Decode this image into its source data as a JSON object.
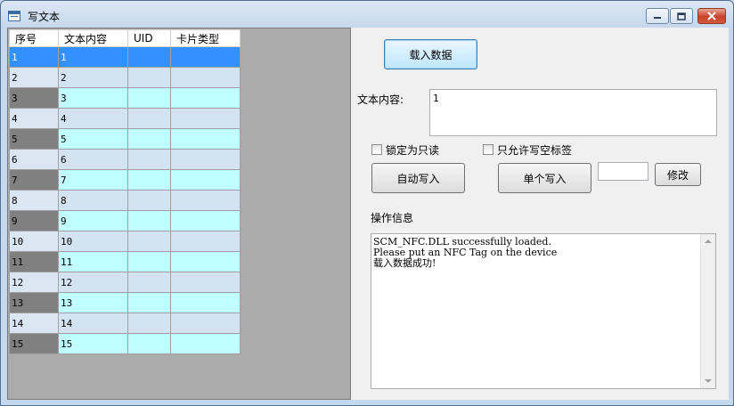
{
  "window": {
    "title": "写文本"
  },
  "grid": {
    "headers": [
      "序号",
      "文本内容",
      "UID",
      "卡片类型"
    ],
    "rows": [
      {
        "no": "1",
        "text": "1",
        "uid": "",
        "type": ""
      },
      {
        "no": "2",
        "text": "2",
        "uid": "",
        "type": ""
      },
      {
        "no": "3",
        "text": "3",
        "uid": "",
        "type": ""
      },
      {
        "no": "4",
        "text": "4",
        "uid": "",
        "type": ""
      },
      {
        "no": "5",
        "text": "5",
        "uid": "",
        "type": ""
      },
      {
        "no": "6",
        "text": "6",
        "uid": "",
        "type": ""
      },
      {
        "no": "7",
        "text": "7",
        "uid": "",
        "type": ""
      },
      {
        "no": "8",
        "text": "8",
        "uid": "",
        "type": ""
      },
      {
        "no": "9",
        "text": "9",
        "uid": "",
        "type": ""
      },
      {
        "no": "10",
        "text": "10",
        "uid": "",
        "type": ""
      },
      {
        "no": "11",
        "text": "11",
        "uid": "",
        "type": ""
      },
      {
        "no": "12",
        "text": "12",
        "uid": "",
        "type": ""
      },
      {
        "no": "13",
        "text": "13",
        "uid": "",
        "type": ""
      },
      {
        "no": "14",
        "text": "14",
        "uid": "",
        "type": ""
      },
      {
        "no": "15",
        "text": "15",
        "uid": "",
        "type": ""
      }
    ],
    "selected_row": "1"
  },
  "form": {
    "load_button": "载入数据",
    "text_content_label": "文本内容:",
    "text_content_value": "1",
    "lock_readonly_label": "锁定为只读",
    "only_blank_label": "只允许写空标签",
    "auto_write_button": "自动写入",
    "single_write_button": "单个写入",
    "single_value": "",
    "modify_button": "修改",
    "log_label": "操作信息",
    "log_text": "SCM_NFC.DLL successfully loaded.\nPlease put an NFC Tag on the device\n载入数据成功!"
  },
  "colors": {
    "selected_row": "#3390ff",
    "cyan_row": "#c0ffff",
    "blue_row": "#d4e3f2",
    "row_header_dark": "#808080",
    "grid_background": "#ababab"
  }
}
